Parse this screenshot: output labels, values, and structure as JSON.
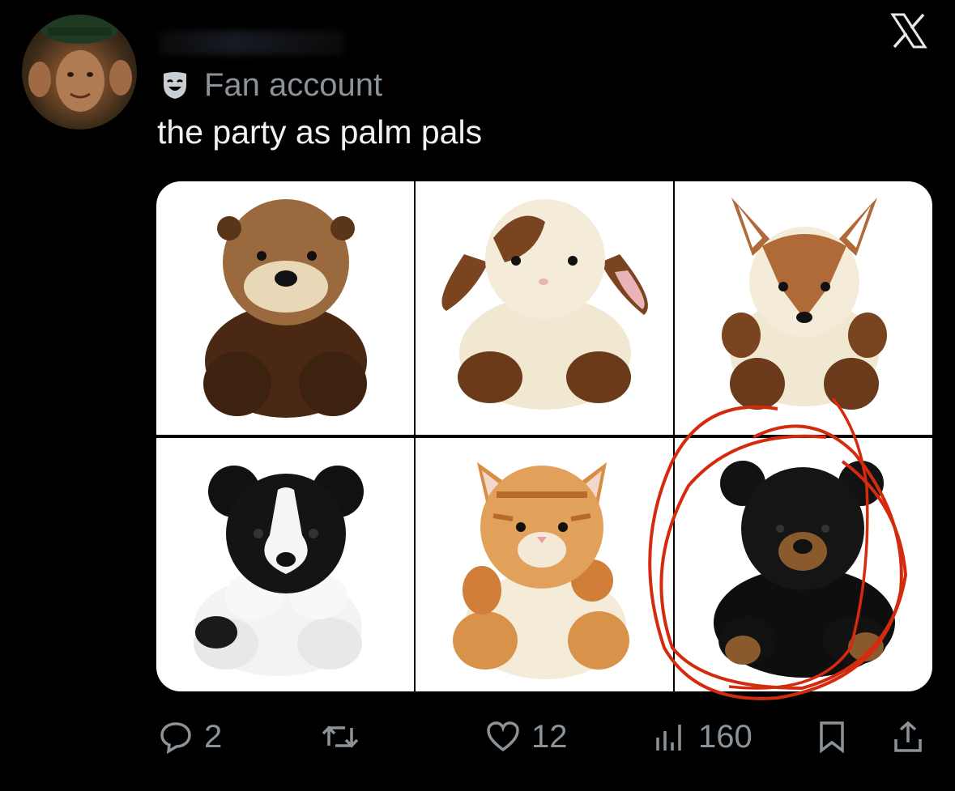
{
  "post": {
    "author_badge": "Fan account",
    "text": "the party as palm pals"
  },
  "icons": {
    "badge": "theater-masks-icon",
    "brand": "x-logo-icon",
    "reply": "reply-icon",
    "repost": "repost-icon",
    "like": "like-icon",
    "views": "views-icon",
    "bookmark": "bookmark-icon",
    "share": "share-icon"
  },
  "media": {
    "images": [
      "otter-plush",
      "bunny-plush",
      "fawn-plush",
      "dog-plush",
      "cat-plush",
      "black-bear-plush"
    ],
    "annotation_color": "#d42a0e"
  },
  "actions": {
    "replies": "2",
    "likes": "12",
    "views": "160"
  },
  "colors": {
    "background": "#000000",
    "muted": "#8b9298",
    "text": "#f2f2f2"
  }
}
